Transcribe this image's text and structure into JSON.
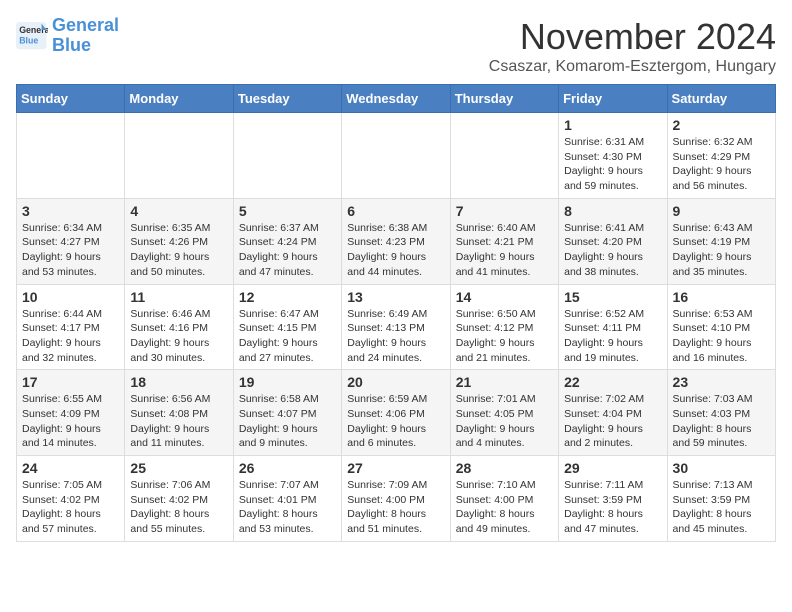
{
  "logo": {
    "line1": "General",
    "line2": "Blue"
  },
  "title": "November 2024",
  "location": "Csaszar, Komarom-Esztergom, Hungary",
  "days_of_week": [
    "Sunday",
    "Monday",
    "Tuesday",
    "Wednesday",
    "Thursday",
    "Friday",
    "Saturday"
  ],
  "weeks": [
    [
      {
        "day": "",
        "info": ""
      },
      {
        "day": "",
        "info": ""
      },
      {
        "day": "",
        "info": ""
      },
      {
        "day": "",
        "info": ""
      },
      {
        "day": "",
        "info": ""
      },
      {
        "day": "1",
        "info": "Sunrise: 6:31 AM\nSunset: 4:30 PM\nDaylight: 9 hours and 59 minutes."
      },
      {
        "day": "2",
        "info": "Sunrise: 6:32 AM\nSunset: 4:29 PM\nDaylight: 9 hours and 56 minutes."
      }
    ],
    [
      {
        "day": "3",
        "info": "Sunrise: 6:34 AM\nSunset: 4:27 PM\nDaylight: 9 hours and 53 minutes."
      },
      {
        "day": "4",
        "info": "Sunrise: 6:35 AM\nSunset: 4:26 PM\nDaylight: 9 hours and 50 minutes."
      },
      {
        "day": "5",
        "info": "Sunrise: 6:37 AM\nSunset: 4:24 PM\nDaylight: 9 hours and 47 minutes."
      },
      {
        "day": "6",
        "info": "Sunrise: 6:38 AM\nSunset: 4:23 PM\nDaylight: 9 hours and 44 minutes."
      },
      {
        "day": "7",
        "info": "Sunrise: 6:40 AM\nSunset: 4:21 PM\nDaylight: 9 hours and 41 minutes."
      },
      {
        "day": "8",
        "info": "Sunrise: 6:41 AM\nSunset: 4:20 PM\nDaylight: 9 hours and 38 minutes."
      },
      {
        "day": "9",
        "info": "Sunrise: 6:43 AM\nSunset: 4:19 PM\nDaylight: 9 hours and 35 minutes."
      }
    ],
    [
      {
        "day": "10",
        "info": "Sunrise: 6:44 AM\nSunset: 4:17 PM\nDaylight: 9 hours and 32 minutes."
      },
      {
        "day": "11",
        "info": "Sunrise: 6:46 AM\nSunset: 4:16 PM\nDaylight: 9 hours and 30 minutes."
      },
      {
        "day": "12",
        "info": "Sunrise: 6:47 AM\nSunset: 4:15 PM\nDaylight: 9 hours and 27 minutes."
      },
      {
        "day": "13",
        "info": "Sunrise: 6:49 AM\nSunset: 4:13 PM\nDaylight: 9 hours and 24 minutes."
      },
      {
        "day": "14",
        "info": "Sunrise: 6:50 AM\nSunset: 4:12 PM\nDaylight: 9 hours and 21 minutes."
      },
      {
        "day": "15",
        "info": "Sunrise: 6:52 AM\nSunset: 4:11 PM\nDaylight: 9 hours and 19 minutes."
      },
      {
        "day": "16",
        "info": "Sunrise: 6:53 AM\nSunset: 4:10 PM\nDaylight: 9 hours and 16 minutes."
      }
    ],
    [
      {
        "day": "17",
        "info": "Sunrise: 6:55 AM\nSunset: 4:09 PM\nDaylight: 9 hours and 14 minutes."
      },
      {
        "day": "18",
        "info": "Sunrise: 6:56 AM\nSunset: 4:08 PM\nDaylight: 9 hours and 11 minutes."
      },
      {
        "day": "19",
        "info": "Sunrise: 6:58 AM\nSunset: 4:07 PM\nDaylight: 9 hours and 9 minutes."
      },
      {
        "day": "20",
        "info": "Sunrise: 6:59 AM\nSunset: 4:06 PM\nDaylight: 9 hours and 6 minutes."
      },
      {
        "day": "21",
        "info": "Sunrise: 7:01 AM\nSunset: 4:05 PM\nDaylight: 9 hours and 4 minutes."
      },
      {
        "day": "22",
        "info": "Sunrise: 7:02 AM\nSunset: 4:04 PM\nDaylight: 9 hours and 2 minutes."
      },
      {
        "day": "23",
        "info": "Sunrise: 7:03 AM\nSunset: 4:03 PM\nDaylight: 8 hours and 59 minutes."
      }
    ],
    [
      {
        "day": "24",
        "info": "Sunrise: 7:05 AM\nSunset: 4:02 PM\nDaylight: 8 hours and 57 minutes."
      },
      {
        "day": "25",
        "info": "Sunrise: 7:06 AM\nSunset: 4:02 PM\nDaylight: 8 hours and 55 minutes."
      },
      {
        "day": "26",
        "info": "Sunrise: 7:07 AM\nSunset: 4:01 PM\nDaylight: 8 hours and 53 minutes."
      },
      {
        "day": "27",
        "info": "Sunrise: 7:09 AM\nSunset: 4:00 PM\nDaylight: 8 hours and 51 minutes."
      },
      {
        "day": "28",
        "info": "Sunrise: 7:10 AM\nSunset: 4:00 PM\nDaylight: 8 hours and 49 minutes."
      },
      {
        "day": "29",
        "info": "Sunrise: 7:11 AM\nSunset: 3:59 PM\nDaylight: 8 hours and 47 minutes."
      },
      {
        "day": "30",
        "info": "Sunrise: 7:13 AM\nSunset: 3:59 PM\nDaylight: 8 hours and 45 minutes."
      }
    ]
  ]
}
